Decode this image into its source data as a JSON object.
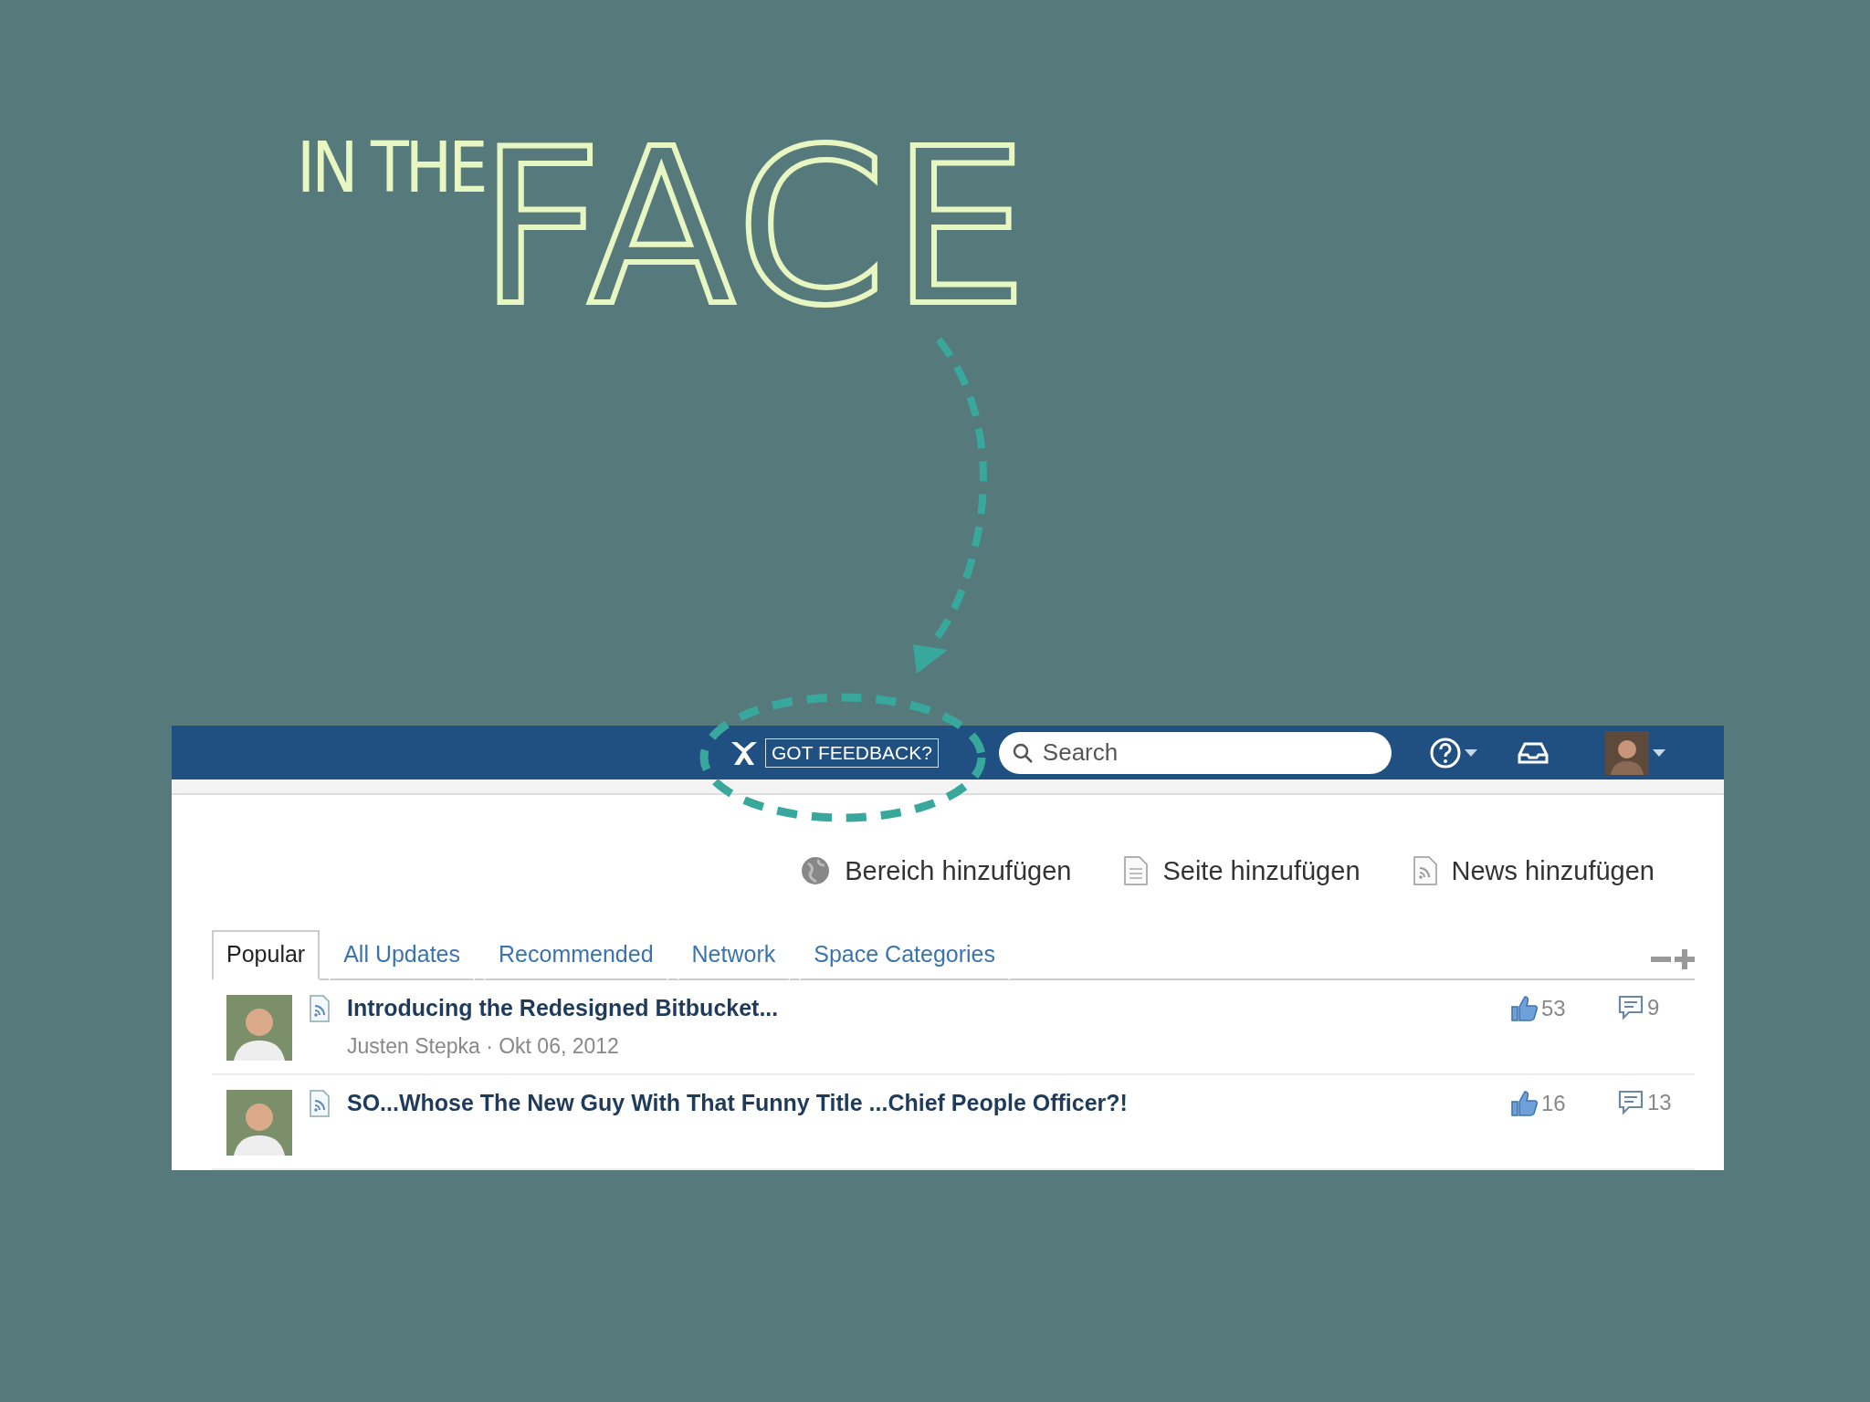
{
  "slide": {
    "title_small": "IN THE",
    "title_large": "FACE"
  },
  "header": {
    "feedback": "GOT FEEDBACK?",
    "search": {
      "placeholder": "Search"
    }
  },
  "actions": [
    {
      "kind": "space",
      "label": "Bereich hinzufügen"
    },
    {
      "kind": "page",
      "label": "Seite hinzufügen"
    },
    {
      "kind": "news",
      "label": "News hinzufügen"
    }
  ],
  "tabs": [
    {
      "label": "Popular",
      "selected": true
    },
    {
      "label": "All Updates",
      "selected": false
    },
    {
      "label": "Recommended",
      "selected": false
    },
    {
      "label": "Network",
      "selected": false
    },
    {
      "label": "Space Categories",
      "selected": false
    }
  ],
  "feed": [
    {
      "title": "Introducing the Redesigned Bitbucket...",
      "meta": "Justen Stepka · Okt 06, 2012",
      "likes": "53",
      "comments": "9"
    },
    {
      "title": "SO...Whose The New Guy With That Funny Title ...Chief People Officer?!",
      "likes": "16",
      "comments": "13"
    }
  ]
}
